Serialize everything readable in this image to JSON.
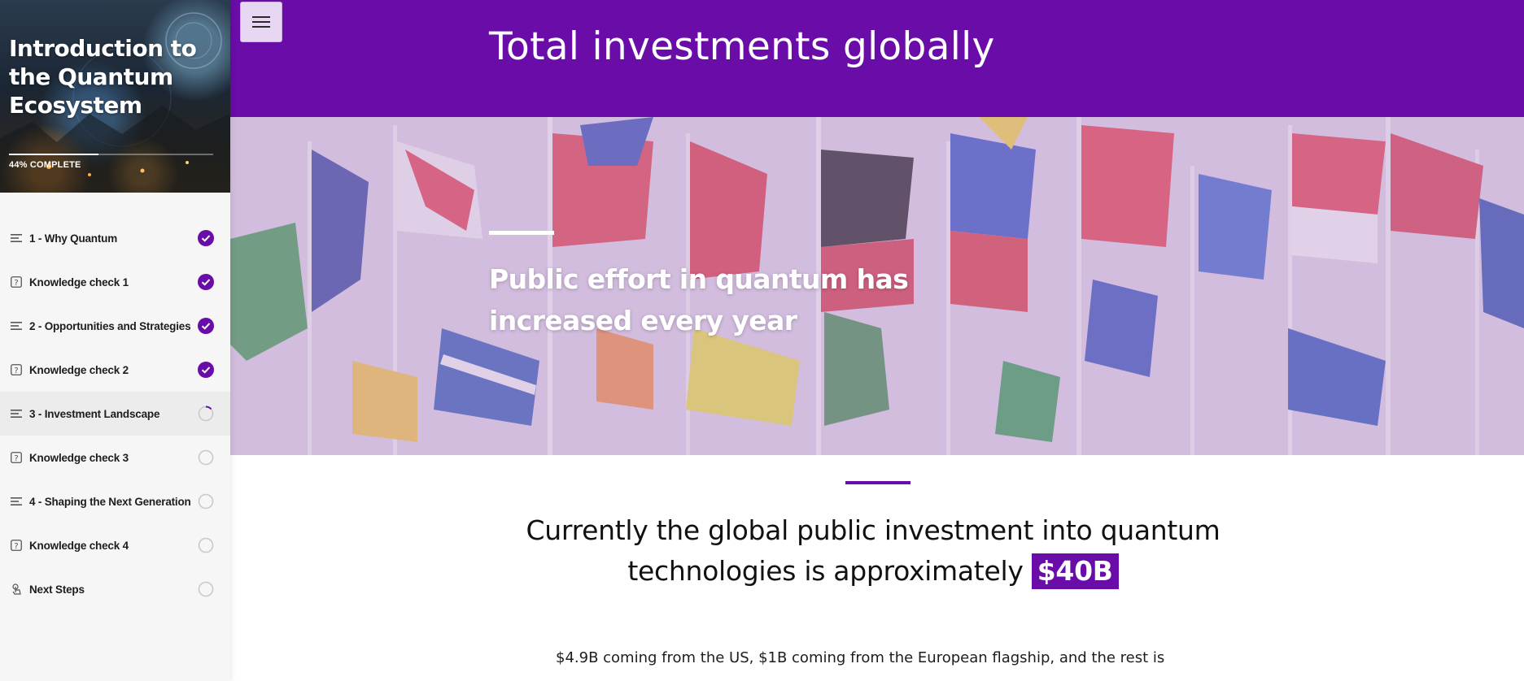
{
  "course": {
    "title": "Introduction to the Quantum Ecosystem",
    "progress_label": "44% COMPLETE",
    "progress_fraction": 0.44
  },
  "lessons": [
    {
      "label": "1 - Why Quantum",
      "icon": "lines-icon",
      "status": "complete"
    },
    {
      "label": "Knowledge check 1",
      "icon": "question-icon",
      "status": "complete"
    },
    {
      "label": "2 - Opportunities and Strategies",
      "icon": "lines-icon",
      "status": "complete"
    },
    {
      "label": "Knowledge check 2",
      "icon": "question-icon",
      "status": "complete"
    },
    {
      "label": "3 - Investment Landscape",
      "icon": "lines-icon",
      "status": "in-progress"
    },
    {
      "label": "Knowledge check 3",
      "icon": "question-icon",
      "status": "not-started"
    },
    {
      "label": "4 - Shaping the Next Generation",
      "icon": "lines-icon",
      "status": "not-started"
    },
    {
      "label": "Knowledge check 4",
      "icon": "question-icon",
      "status": "not-started"
    },
    {
      "label": "Next Steps",
      "icon": "touch-icon",
      "status": "not-started"
    }
  ],
  "header": {
    "menu_icon": "hamburger-icon",
    "title": "Total investments globally"
  },
  "banner": {
    "heading": "Public effort in quantum has increased every year"
  },
  "statement": {
    "text": "Currently the global public investment into quantum technologies is approximately",
    "highlight": "$40B"
  },
  "body": {
    "text": "$4.9B coming from the US, $1B coming from the European flagship, and the rest is"
  },
  "colors": {
    "accent": "#6a0ca8",
    "sidebar_bg": "#f6f6f6",
    "banner_tint": "#c4a0d6"
  }
}
